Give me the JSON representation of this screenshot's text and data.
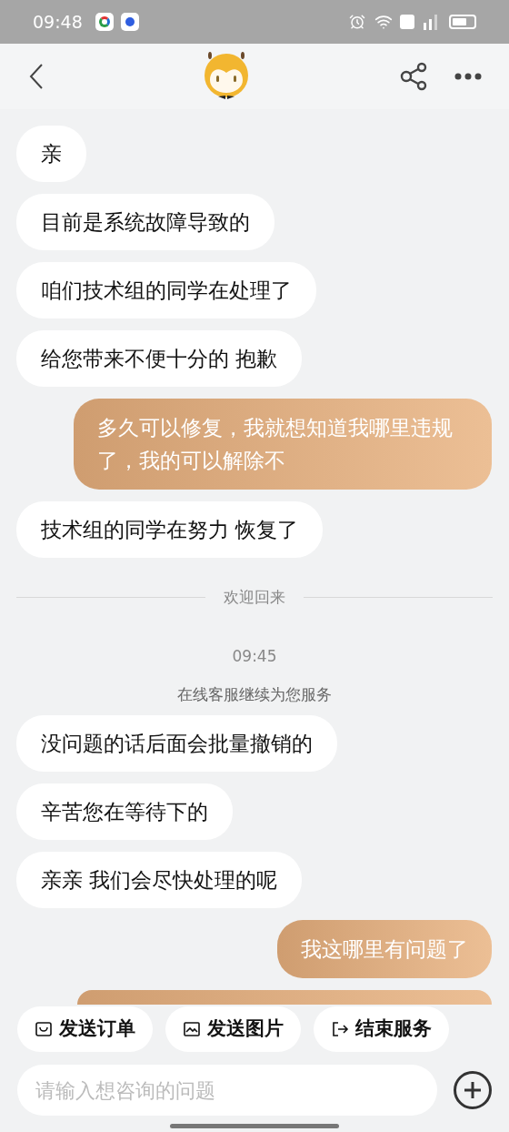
{
  "status_bar": {
    "time": "09:48"
  },
  "messages": [
    {
      "kind": "agent",
      "text": "亲"
    },
    {
      "kind": "agent",
      "text": "目前是系统故障导致的"
    },
    {
      "kind": "agent",
      "text": "咱们技术组的同学在处理了"
    },
    {
      "kind": "agent",
      "text": "给您带来不便十分的 抱歉"
    },
    {
      "kind": "user",
      "text": "多久可以修复，我就想知道我哪里违规了，我的可以解除不"
    },
    {
      "kind": "agent",
      "text": "技术组的同学在努力 恢复了"
    },
    {
      "kind": "divider",
      "text": "欢迎回来"
    },
    {
      "kind": "time",
      "text": "09:45"
    },
    {
      "kind": "system",
      "text": "在线客服继续为您服务"
    },
    {
      "kind": "agent",
      "text": "没问题的话后面会批量撤销的"
    },
    {
      "kind": "agent",
      "text": "辛苦您在等待下的"
    },
    {
      "kind": "agent",
      "text": "亲亲 我们会尽快处理的呢"
    },
    {
      "kind": "user",
      "text": "我这哪里有问题了"
    },
    {
      "kind": "user_partial"
    }
  ],
  "quick_actions": [
    {
      "kind": "order",
      "label": "发送订单"
    },
    {
      "kind": "image",
      "label": "发送图片"
    },
    {
      "kind": "exit",
      "label": "结束服务"
    }
  ],
  "input": {
    "placeholder": "请输入想咨询的问题"
  }
}
